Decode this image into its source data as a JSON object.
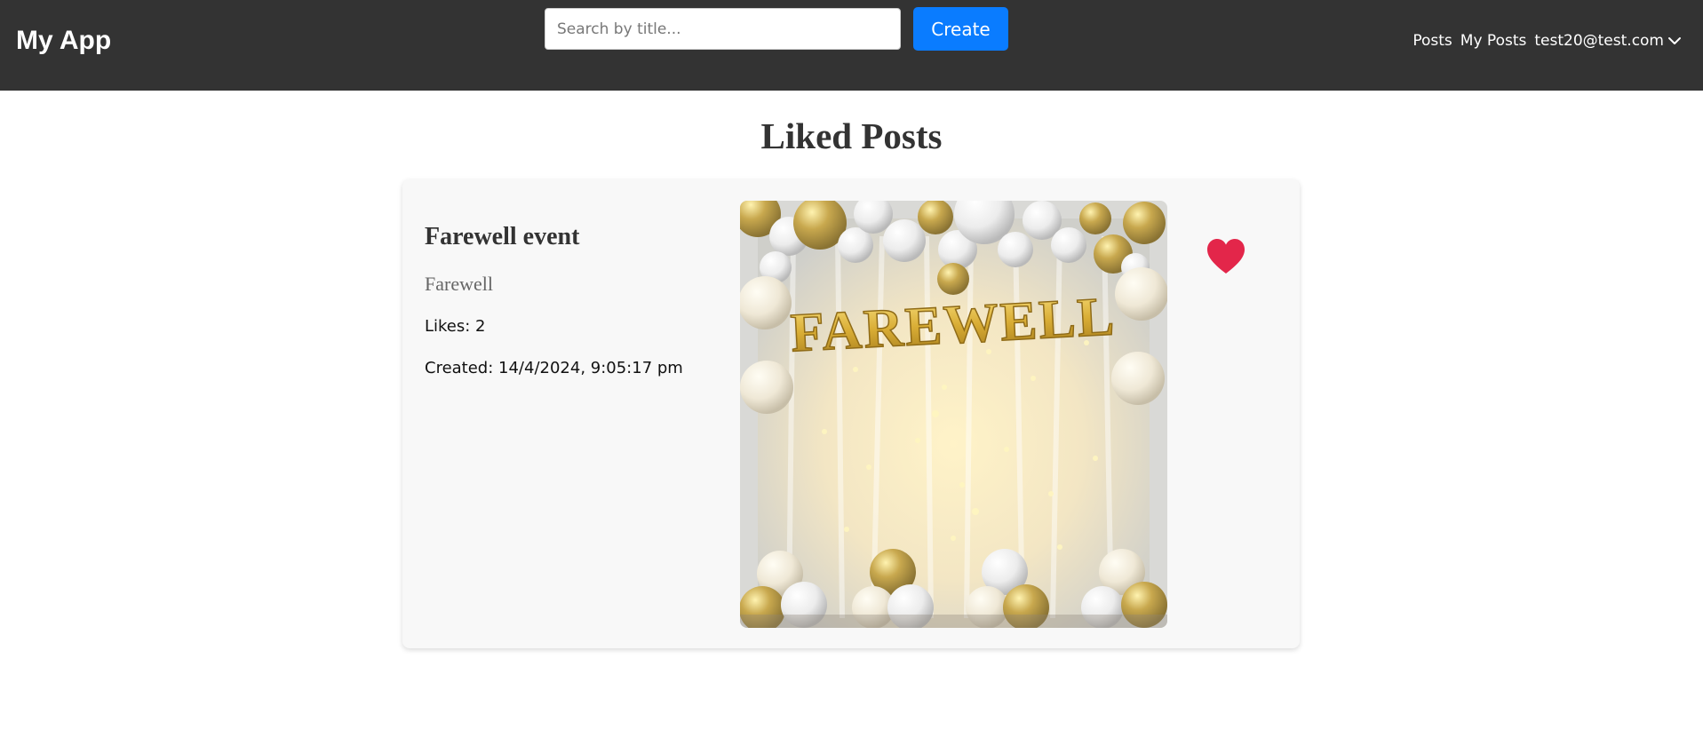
{
  "app": {
    "brand": "My App"
  },
  "search": {
    "placeholder": "Search by title..."
  },
  "toolbar": {
    "create_label": "Create"
  },
  "nav": {
    "posts_label": "Posts",
    "my_posts_label": "My Posts",
    "user_email": "test20@test.com",
    "user_menu_icon": "chevron-down-icon"
  },
  "page": {
    "title": "Liked Posts"
  },
  "post": {
    "title": "Farewell event",
    "description": "Farewell",
    "likes_text": "Likes: 2",
    "created_text": "Created: 14/4/2024, 9:05:17 pm",
    "image_caption": "FAREWELL",
    "liked": true,
    "like_icon": "heart-icon"
  },
  "colors": {
    "navbar": "#333333",
    "accent": "#0a7cff",
    "heart": "#e3264a",
    "card": "#f8f8f8"
  }
}
